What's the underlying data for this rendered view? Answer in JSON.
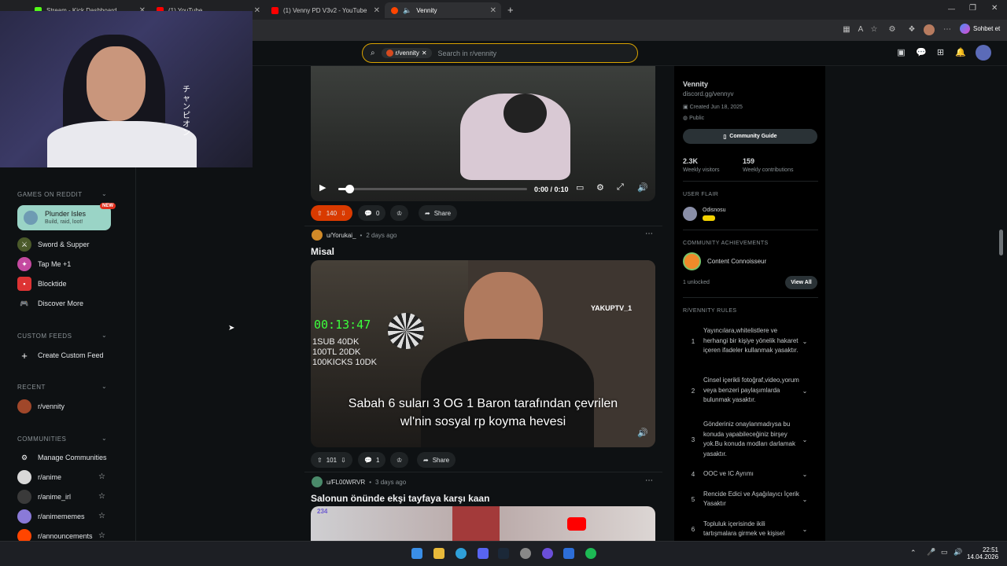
{
  "browser": {
    "tabs": [
      {
        "label": "Stream - Kick Dashboard",
        "color": "#53fc18"
      },
      {
        "label": "(1) YouTube",
        "color": "#ff0000"
      },
      {
        "label": "(1) Venny PD V3v2 - YouTube",
        "color": "#ff0000"
      },
      {
        "label": "Vennity",
        "color": "#ff4500"
      }
    ],
    "copilot_label": "Sohbet et"
  },
  "header": {
    "search_chip": "r/vennity",
    "search_placeholder": "Search in r/vennity"
  },
  "sidebar": {
    "games_heading": "GAMES ON REDDIT",
    "games": [
      {
        "label": "Plunder Isles",
        "sub": "Build, raid, loot!",
        "badge": "NEW"
      },
      {
        "label": "Sword & Supper"
      },
      {
        "label": "Tap Me +1"
      },
      {
        "label": "Blocktide"
      },
      {
        "label": "Discover More"
      }
    ],
    "custom_heading": "CUSTOM FEEDS",
    "create_feed": "Create Custom Feed",
    "recent_heading": "RECENT",
    "recent": [
      "r/vennity"
    ],
    "communities_heading": "COMMUNITIES",
    "manage": "Manage Communities",
    "communities": [
      "r/anime",
      "r/anime_irl",
      "r/animememes",
      "r/announcements"
    ]
  },
  "feed": {
    "post1": {
      "time": "0:00 / 0:10",
      "votes": "140",
      "comments": "0",
      "share": "Share",
      "progress": 0.06
    },
    "post2": {
      "author": "u/Yorukai_",
      "age": "2 days ago",
      "title": "Misal",
      "overlay_timer": "00:13:47",
      "overlay_list": [
        "1SUB 40DK",
        "100TL 20DK",
        "100KICKS 10DK"
      ],
      "overlay_brand": "YAKUPTV_1",
      "caption1": "Sabah 6 suları 3 OG 1 Baron tarafından çevrilen",
      "caption2": "wl'nin sosyal rp koyma hevesi",
      "votes": "101",
      "comments": "1",
      "share": "Share"
    },
    "post3": {
      "author": "u/FL00WRVR",
      "age": "3 days ago",
      "title": "Salonun önünde ekşi tayfaya karşı kaan",
      "viewer_count": "234"
    }
  },
  "community": {
    "name": "Vennity",
    "link": "discord.gg/vennyv",
    "created": "Created Jun 18, 2025",
    "visibility": "Public",
    "guide_button": "Community Guide",
    "visitors_value": "2.3K",
    "visitors_label": "Weekly visitors",
    "contrib_value": "159",
    "contrib_label": "Weekly contributions",
    "flair_heading": "USER FLAIR",
    "flair_user": "Odisnosu",
    "achievements_heading": "COMMUNITY ACHIEVEMENTS",
    "achievement": "Content Connoisseur",
    "unlocked": "1 unlocked",
    "view_all": "View All",
    "rules_heading": "R/VENNITY RULES",
    "rules": [
      {
        "num": "1",
        "text": "Yayıncılara,whitelistlere ve herhangi bir kişiye yönelik hakaret içeren ifadeler kullanmak yasaktır."
      },
      {
        "num": "2",
        "text": "Cinsel içerikli fotoğraf,video,yorum veya benzeri paylaşımlarda bulunmak yasaktır."
      },
      {
        "num": "3",
        "text": "Gönderiniz onaylanmadıysa bu konuda yapabileceğiniz birşey yok.Bu konuda modları darlamak yasaktır."
      },
      {
        "num": "4",
        "text": "OOC ve IC Ayrımı"
      },
      {
        "num": "5",
        "text": "Rencide Edici ve Aşağılayıcı İçerik Yasaktır"
      },
      {
        "num": "6",
        "text": "Topluluk içerisinde ikili tartışmalara girmek ve kişisel"
      }
    ]
  },
  "webcam": {
    "text": "チャンピオン"
  },
  "taskbar": {
    "time": "22:51",
    "date": "14.04.2026"
  }
}
